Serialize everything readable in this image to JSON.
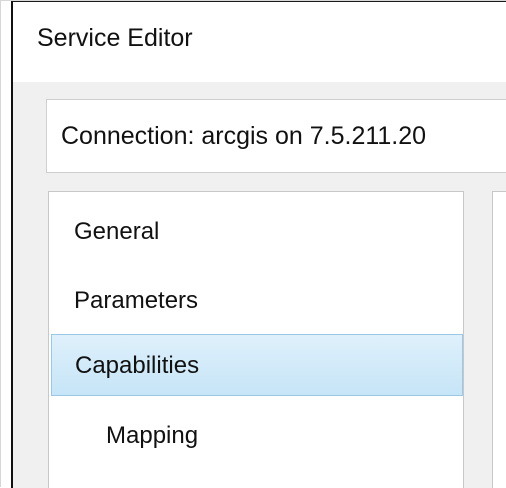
{
  "window": {
    "title": "Service Editor"
  },
  "connection": {
    "label": "Connection: arcgis on 7.5.211.20"
  },
  "sidebar": {
    "items": [
      {
        "label": "General"
      },
      {
        "label": "Parameters"
      },
      {
        "label": "Capabilities",
        "selected": true
      },
      {
        "label": "Mapping"
      }
    ]
  },
  "colors": {
    "window_background": "#f0f0f0",
    "panel_background": "#ffffff",
    "selection_top": "#dff0fb",
    "selection_bottom": "#c6e5f7",
    "selection_border": "#9bc8e6"
  }
}
